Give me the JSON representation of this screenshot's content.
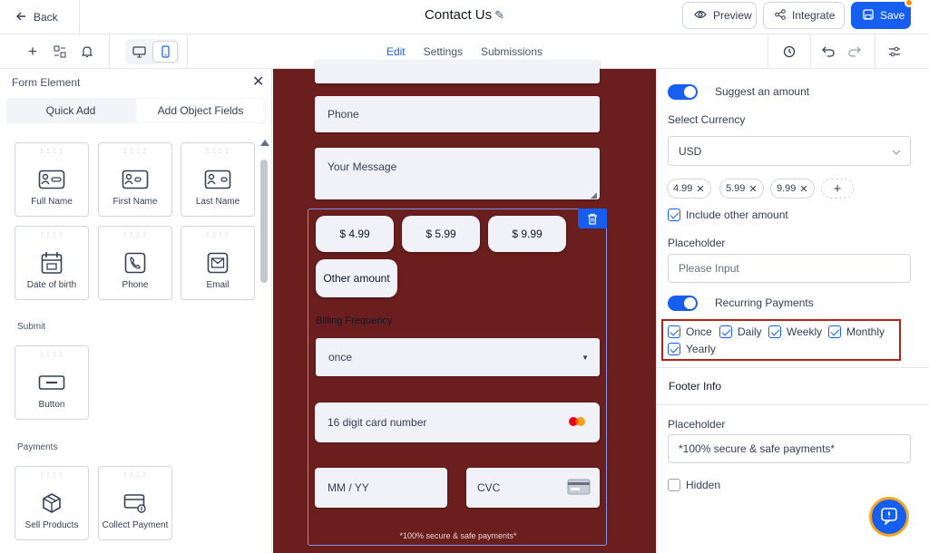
{
  "header": {
    "back_label": "Back",
    "title": "Contact Us",
    "preview_label": "Preview",
    "integrate_label": "Integrate",
    "save_label": "Save"
  },
  "toolbar": {
    "tabs": [
      {
        "label": "Edit"
      },
      {
        "label": "Settings"
      },
      {
        "label": "Submissions"
      }
    ]
  },
  "left_panel": {
    "title": "Form Element",
    "segments": [
      "Quick Add",
      "Add Object Fields"
    ],
    "elements": [
      {
        "label": "Full Name",
        "icon": "contact-card-icon"
      },
      {
        "label": "First Name",
        "icon": "contact-card-icon"
      },
      {
        "label": "Last Name",
        "icon": "contact-card-icon"
      },
      {
        "label": "Date of birth",
        "icon": "calendar-icon"
      },
      {
        "label": "Phone",
        "icon": "phone-icon"
      },
      {
        "label": "Email",
        "icon": "email-icon"
      }
    ],
    "submit_section": "Submit",
    "submit_elements": [
      {
        "label": "Button",
        "icon": "button-icon"
      }
    ],
    "payments_section": "Payments",
    "payment_elements": [
      {
        "label": "Sell Products",
        "icon": "box-icon"
      },
      {
        "label": "Collect Payment",
        "icon": "card-payment-icon"
      }
    ]
  },
  "form": {
    "phone_placeholder": "Phone",
    "message_placeholder": "Your Message",
    "amounts": [
      "$ 4.99",
      "$ 5.99",
      "$ 9.99"
    ],
    "other_amount": "Other amount",
    "billing_label": "Billing Frequency",
    "billing_value": "once",
    "card_placeholder": "16 digit card number",
    "expiry_placeholder": "MM / YY",
    "cvc_placeholder": "CVC",
    "footer": "*100% secure & safe payments*"
  },
  "right_panel": {
    "suggest_amount_label": "Suggest an amount",
    "currency_label": "Select Currency",
    "currency_value": "USD",
    "amount_pills": [
      "4.99",
      "5.99",
      "9.99"
    ],
    "include_other_label": "Include other amount",
    "placeholder_label": "Placeholder",
    "placeholder_input": "Please Input",
    "recurring_label": "Recurring Payments",
    "frequencies": [
      "Once",
      "Daily",
      "Weekly",
      "Monthly",
      "Yearly"
    ],
    "footer_info_label": "Footer Info",
    "footer_placeholder_label": "Placeholder",
    "footer_placeholder_value": "*100% secure & safe payments*",
    "hidden_label": "Hidden"
  },
  "colors": {
    "accent": "#155eef",
    "canvas_bg": "#6b1e1e",
    "highlight": "#b42318"
  }
}
